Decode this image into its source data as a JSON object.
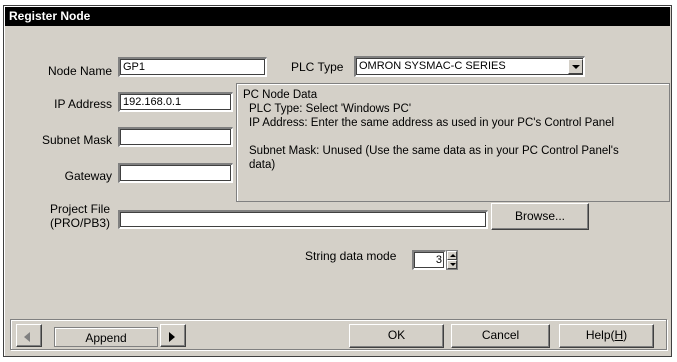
{
  "window": {
    "title": "Register Node"
  },
  "form": {
    "node_name_label": "Node Name",
    "node_name_value": "GP1",
    "plc_type_label": "PLC Type",
    "plc_type_value": "OMRON SYSMAC-C SERIES",
    "ip_address_label": "IP Address",
    "ip_address_value": "192.168.0.1",
    "subnet_mask_label": "Subnet Mask",
    "subnet_mask_value": "",
    "gateway_label": "Gateway",
    "gateway_value": "",
    "project_file_label_line1": "Project File",
    "project_file_label_line2": "(PRO/PB3)",
    "project_file_value": "",
    "browse_label": "Browse...",
    "string_mode_label": "String data mode",
    "string_mode_value": "3"
  },
  "info": {
    "heading": "PC Node Data",
    "line1": "PLC Type: Select 'Windows PC'",
    "line2": "IP Address: Enter the same address as used in your PC's Control Panel",
    "line3": "Subnet Mask: Unused (Use the same data as in your PC Control Panel's",
    "line4": "data)"
  },
  "footer": {
    "append_label": "Append",
    "ok_label": "OK",
    "cancel_label": "Cancel",
    "help_label": "Help(",
    "help_accel": "H",
    "help_close": ")"
  },
  "colors": {
    "face": "#d4d0c8",
    "title_bg": "#000000",
    "title_fg": "#ffffff"
  }
}
